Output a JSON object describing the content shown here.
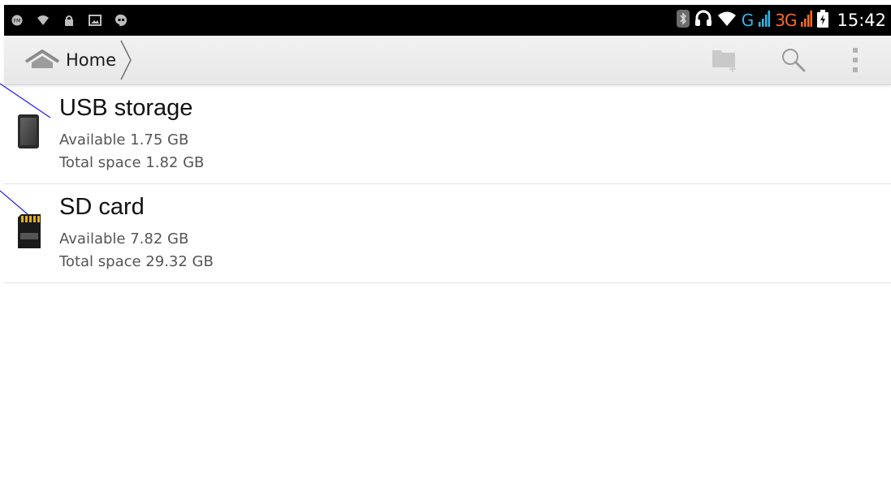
{
  "status_bar": {
    "left_icons": [
      "fm-radio-icon",
      "wifi-signal-icon",
      "lock-icon",
      "image-icon",
      "hangouts-icon"
    ],
    "right_icons": [
      "bluetooth-icon",
      "headset-icon",
      "wifi-icon",
      "signal-bars-icon",
      "battery-icon"
    ],
    "network_g": "G",
    "network_3g": "3G",
    "time": "15:42"
  },
  "action_bar": {
    "breadcrumb_home": "Home",
    "actions": [
      "new-folder-icon",
      "search-icon",
      "overflow-menu-icon"
    ]
  },
  "storage_list": [
    {
      "name": "USB storage",
      "available": "Available 1.75 GB",
      "total": "Total space 1.82 GB",
      "icon": "usb-storage-icon"
    },
    {
      "name": "SD card",
      "available": "Available 7.82 GB",
      "total": "Total space 29.32 GB",
      "icon": "sd-card-icon"
    }
  ],
  "colors": {
    "status_bar_bg": "#000000",
    "action_bar_bg": "#eeeeee",
    "network_g": "#33b5e5",
    "network_3g": "#ff6a1a",
    "annotation_line": "#1a1aff"
  }
}
